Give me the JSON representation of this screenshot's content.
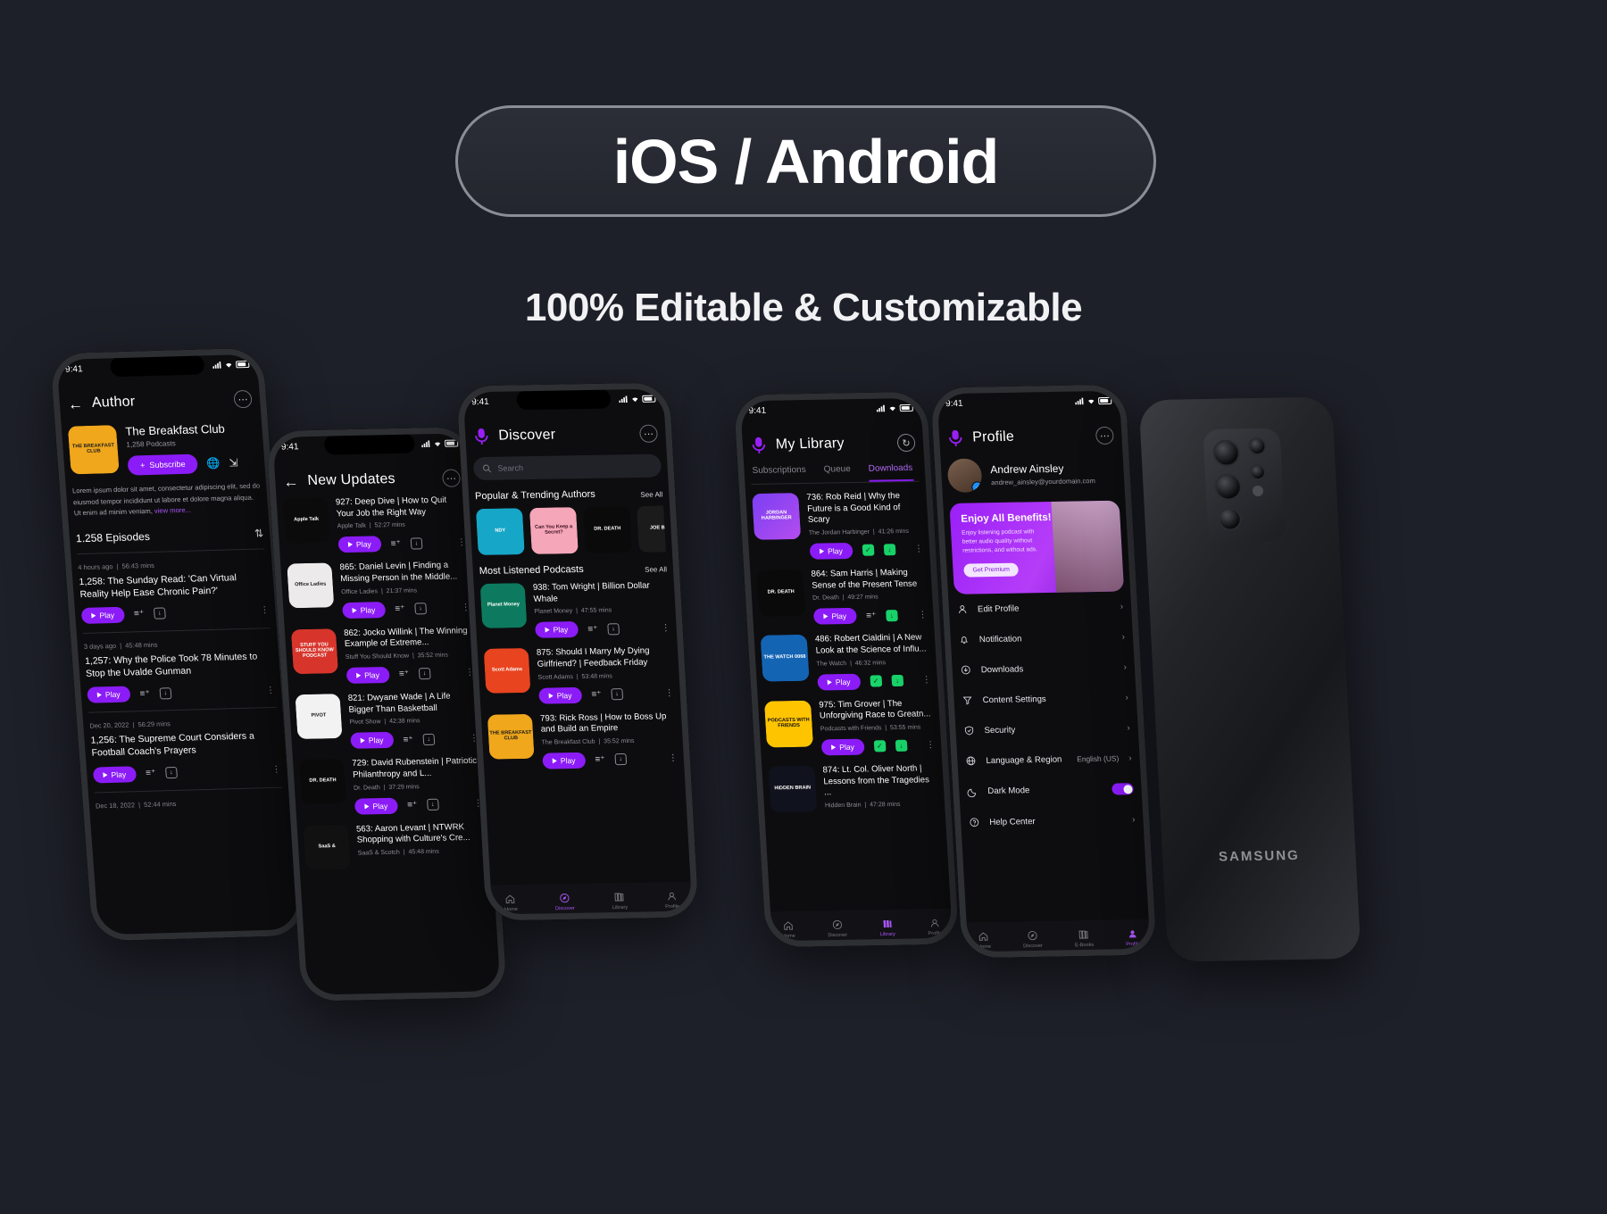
{
  "header": {
    "badge_text": "iOS / Android",
    "subtitle": "100% Editable & Customizable"
  },
  "colors": {
    "background": "#1e2029",
    "accent": "#8b1cf7",
    "accent_light": "#b46cfb",
    "screen_bg": "#0d0d0f",
    "green": "#19d46a",
    "verified_blue": "#1f8ff5"
  },
  "status_bar": {
    "time": "9:41"
  },
  "phones": [
    {
      "id": "author",
      "app_title": "Author",
      "back_icon": "arrow-left-icon",
      "more_icon": "more-horizontal-icon",
      "podcast": {
        "name": "The Breakfast Club",
        "artwork_label": "THE BREAKFAST CLUB",
        "count": "1,258 Podcasts",
        "subscribe_label": "Subscribe",
        "subscribe_plus": "+",
        "globe_icon": "globe-icon",
        "share_icon": "share-icon",
        "description": "Lorem ipsum dolor sit amet, consectetur adipiscing elit, sed do eiusmod tempor incididunt ut labore et dolore magna aliqua. Ut enim ad minim veniam,",
        "view_more": "view more..."
      },
      "episodes_header": "1.258 Episodes",
      "sort_icon": "sort-icon",
      "episodes": [
        {
          "ago": "4 hours ago",
          "duration": "56:43 mins",
          "title": "1,258: The Sunday Read: 'Can Virtual Reality Help Ease Chronic Pain?'",
          "play": "Play"
        },
        {
          "ago": "3 days ago",
          "duration": "45:48 mins",
          "title": "1,257: Why the Police Took 78 Minutes to Stop the Uvalde Gunman",
          "play": "Play"
        },
        {
          "ago": "Dec 20, 2022",
          "duration": "56:29 mins",
          "title": "1,256: The Supreme Court Considers a Football Coach's Prayers",
          "play": "Play"
        },
        {
          "ago": "Dec 18, 2022",
          "duration": "52:44 mins",
          "title": "",
          "play": "Play"
        }
      ]
    },
    {
      "id": "new-updates",
      "app_title": "New Updates",
      "back_icon": "arrow-left-icon",
      "more_icon": "more-horizontal-icon",
      "items": [
        {
          "title": "927: Deep Dive | How to Quit Your Job the Right Way",
          "author": "Apple Talk",
          "duration": "52:27 mins",
          "art": "Apple Talk",
          "art_class": "aw-apple",
          "play": "Play"
        },
        {
          "title": "865: Daniel Levin | Finding a Missing Person in the Middle...",
          "author": "Office Ladies",
          "duration": "21:37 mins",
          "art": "Office Ladies",
          "art_class": "aw-office",
          "play": "Play"
        },
        {
          "title": "862: Jocko Willink | The Winning Example of Extreme...",
          "author": "Stuff You Should Know",
          "duration": "35:52 mins",
          "art": "STUFF YOU SHOULD KNOW PODCAST",
          "art_class": "aw-stuff",
          "play": "Play"
        },
        {
          "title": "821: Dwyane Wade | A Life Bigger Than Basketball",
          "author": "Pivot Show",
          "duration": "42:38 mins",
          "art": "PIVOT",
          "art_class": "aw-pivot",
          "play": "Play"
        },
        {
          "title": "729: David Rubenstein | Patriotic Philanthropy and L...",
          "author": "Dr. Death",
          "duration": "37:29 mins",
          "art": "DR. DEATH",
          "art_class": "aw-death",
          "play": "Play"
        },
        {
          "title": "563: Aaron Levant | NTWRK Shopping with Culture's Cre...",
          "author": "SaaS & Scotch",
          "duration": "45:48 mins",
          "art": "SaaS &",
          "art_class": "aw-dark",
          "play": "Play"
        }
      ]
    },
    {
      "id": "discover",
      "app_title": "Discover",
      "logo_icon": "mic-logo-icon",
      "search_placeholder": "Search",
      "search_icon": "search-icon",
      "sections": [
        {
          "title": "Popular & Trending Authors",
          "see_all": "See All",
          "cards": [
            {
              "label": "NDY",
              "art_class": "aw-teal"
            },
            {
              "label": "Can You Keep a Secret?",
              "art_class": "aw-pink"
            },
            {
              "label": "DR. DEATH",
              "art_class": "aw-death"
            },
            {
              "label": "JOE BUD",
              "art_class": "aw-joe"
            }
          ]
        },
        {
          "title": "Most Listened Podcasts",
          "see_all": "See All"
        }
      ],
      "items": [
        {
          "title": "938: Tom Wright | Billion Dollar Whale",
          "author": "Planet Money",
          "duration": "47:55 mins",
          "art": "Planet Money",
          "art_class": "aw-planet",
          "play": "Play"
        },
        {
          "title": "875: Should I Marry My Dying Girlfriend? | Feedback Friday",
          "author": "Scott Adams",
          "duration": "53:48 mins",
          "art": "Scott Adams",
          "art_class": "aw-scott",
          "play": "Play"
        },
        {
          "title": "793: Rick Ross | How to Boss Up and Build an Empire",
          "author": "The Breakfast Club",
          "duration": "35:52 mins",
          "art": "THE BREAKFAST CLUB",
          "art_class": "aw-breakfast",
          "play": "Play"
        }
      ],
      "bottom_nav": [
        {
          "label": "Home",
          "icon": "home-icon",
          "active": false
        },
        {
          "label": "Discover",
          "icon": "compass-icon",
          "active": true
        },
        {
          "label": "Library",
          "icon": "library-icon",
          "active": false
        },
        {
          "label": "Profile",
          "icon": "person-icon",
          "active": false
        }
      ]
    },
    {
      "id": "my-library",
      "app_title": "My Library",
      "logo_icon": "mic-logo-icon",
      "history_icon": "history-icon",
      "tabs": [
        {
          "label": "Subscriptions",
          "active": false
        },
        {
          "label": "Queue",
          "active": false
        },
        {
          "label": "Downloads",
          "active": true
        }
      ],
      "items": [
        {
          "title": "736: Rob Reid | Why the Future is a Good Kind of Scary",
          "author": "The Jordan Harbinger",
          "duration": "41:26 mins",
          "art": "JORDAN HARBINGER",
          "art_class": "aw-jordan",
          "play": "Play",
          "checked": true,
          "downloaded": true,
          "queue": false
        },
        {
          "title": "864: Sam Harris | Making Sense of the Present Tense",
          "author": "Dr. Death",
          "duration": "49:27 mins",
          "art": "DR. DEATH",
          "art_class": "aw-death",
          "play": "Play",
          "checked": false,
          "downloaded": true,
          "queue": true
        },
        {
          "title": "486: Robert Cialdini | A New Look at the Science of Influ...",
          "author": "The Watch",
          "duration": "46:32 mins",
          "art": "THE WATCH 0068",
          "art_class": "aw-watch",
          "play": "Play",
          "checked": true,
          "downloaded": true,
          "queue": false
        },
        {
          "title": "975: Tim Grover | The Unforgiving Race to Greatn...",
          "author": "Podcasts with Friends",
          "duration": "53:55 mins",
          "art": "PODCASTS WITH FRIENDS",
          "art_class": "aw-friends",
          "play": "Play",
          "checked": true,
          "downloaded": true,
          "queue": false
        },
        {
          "title": "874: Lt. Col. Oliver North | Lessons from the Tragedies ...",
          "author": "Hidden Brain",
          "duration": "47:28 mins",
          "art": "HIDDEN BRAIN",
          "art_class": "aw-hidden",
          "play": "Play",
          "checked": false,
          "downloaded": false,
          "queue": false
        }
      ],
      "bottom_nav": [
        {
          "label": "Home",
          "icon": "home-icon",
          "active": false
        },
        {
          "label": "Discover",
          "icon": "compass-icon",
          "active": false
        },
        {
          "label": "Library",
          "icon": "library-icon",
          "active": true
        },
        {
          "label": "Profile",
          "icon": "person-icon",
          "active": false
        }
      ]
    },
    {
      "id": "profile",
      "app_title": "Profile",
      "logo_icon": "mic-logo-icon",
      "more_icon": "more-horizontal-icon",
      "user": {
        "name": "Andrew Ainsley",
        "email": "andrew_ainsley@yourdomain.com",
        "verified_icon": "verified-badge-icon"
      },
      "promo": {
        "title": "Enjoy All Benefits!",
        "text": "Enjoy listening podcast with better audio quality without restrictions, and without ads.",
        "cta": "Get Premium"
      },
      "settings": [
        {
          "label": "Edit Profile",
          "icon": "person-icon",
          "value": "",
          "type": "chevron"
        },
        {
          "label": "Notification",
          "icon": "bell-icon",
          "value": "",
          "type": "chevron"
        },
        {
          "label": "Downloads",
          "icon": "download-icon",
          "value": "",
          "type": "chevron"
        },
        {
          "label": "Content Settings",
          "icon": "funnel-icon",
          "value": "",
          "type": "chevron"
        },
        {
          "label": "Security",
          "icon": "shield-icon",
          "value": "",
          "type": "chevron"
        },
        {
          "label": "Language & Region",
          "icon": "globe-icon",
          "value": "English (US)",
          "type": "chevron"
        },
        {
          "label": "Dark Mode",
          "icon": "moon-icon",
          "value": "",
          "type": "toggle"
        },
        {
          "label": "Help Center",
          "icon": "help-icon",
          "value": "",
          "type": "chevron"
        }
      ],
      "bottom_nav": [
        {
          "label": "Home",
          "icon": "home-icon",
          "active": false
        },
        {
          "label": "Discover",
          "icon": "compass-icon",
          "active": false
        },
        {
          "label": "E-Books",
          "icon": "library-icon",
          "active": false
        },
        {
          "label": "Profile",
          "icon": "person-icon",
          "active": true
        }
      ]
    }
  ],
  "samsung": {
    "brand": "SAMSUNG"
  }
}
